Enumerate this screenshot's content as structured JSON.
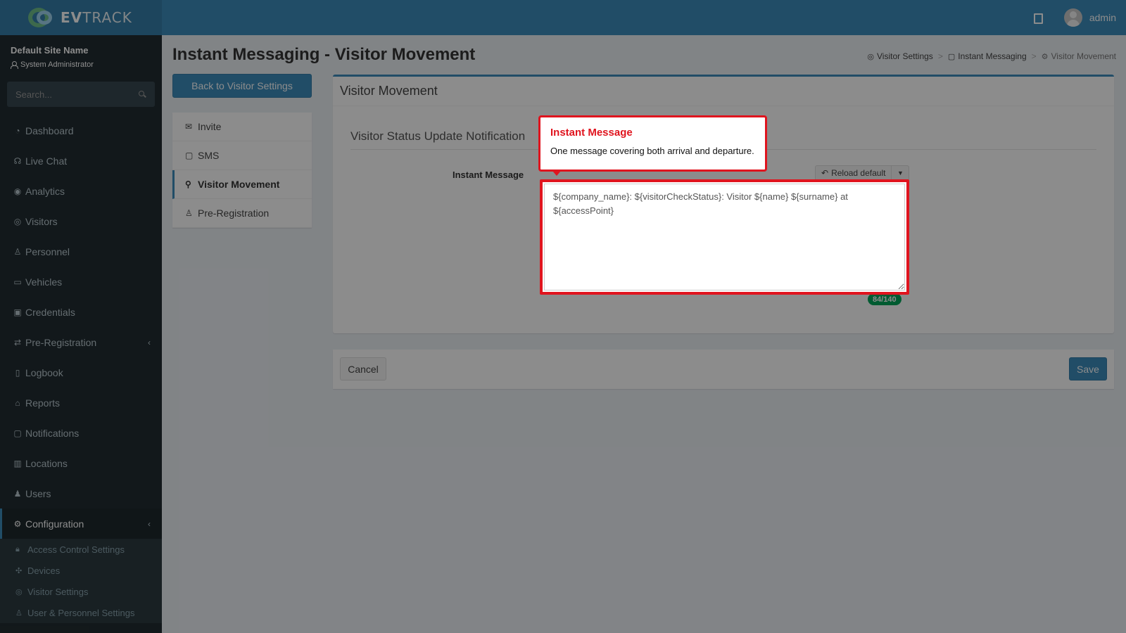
{
  "header": {
    "logo_bold": "EV",
    "logo_light": "TRACK",
    "user_name": "admin"
  },
  "sidebar": {
    "site_name": "Default Site Name",
    "role": "System Administrator",
    "search_placeholder": "Search...",
    "items": [
      {
        "label": "Dashboard",
        "icon": "dashboard-icon"
      },
      {
        "label": "Live Chat",
        "icon": "headset-icon"
      },
      {
        "label": "Analytics",
        "icon": "target-icon"
      },
      {
        "label": "Visitors",
        "icon": "eye-icon"
      },
      {
        "label": "Personnel",
        "icon": "personnel-icon"
      },
      {
        "label": "Vehicles",
        "icon": "car-icon"
      },
      {
        "label": "Credentials",
        "icon": "credentials-icon"
      },
      {
        "label": "Pre-Registration",
        "icon": "arrows-icon"
      },
      {
        "label": "Logbook",
        "icon": "book-icon"
      },
      {
        "label": "Reports",
        "icon": "reports-icon"
      },
      {
        "label": "Notifications",
        "icon": "chat-icon"
      },
      {
        "label": "Locations",
        "icon": "map-icon"
      },
      {
        "label": "Users",
        "icon": "users-icon"
      },
      {
        "label": "Configuration",
        "icon": "gear-icon"
      }
    ],
    "config_submenu": [
      {
        "label": "Access Control Settings",
        "icon": "lock-icon"
      },
      {
        "label": "Devices",
        "icon": "devices-icon"
      },
      {
        "label": "Visitor Settings",
        "icon": "eye-icon"
      },
      {
        "label": "User & Personnel Settings",
        "icon": "user-settings-icon"
      }
    ]
  },
  "page": {
    "title": "Instant Messaging - Visitor Movement",
    "breadcrumb": [
      "Visitor Settings",
      "Instant Messaging",
      "Visitor Movement"
    ],
    "back_button": "Back to Visitor Settings",
    "sub_nav": [
      "Invite",
      "SMS",
      "Visitor Movement",
      "Pre-Registration"
    ],
    "box_title": "Visitor Movement",
    "section_title": "Visitor Status Update Notification",
    "field_label": "Instant Message",
    "reload_label": "Reload default",
    "message": "${company_name}: ${visitorCheckStatus}: Visitor ${name} ${surname} at ${accessPoint}",
    "counter": "84/140",
    "cancel": "Cancel",
    "save": "Save"
  },
  "tooltip": {
    "title": "Instant Message",
    "body": "One message covering both arrival and departure."
  },
  "colors": {
    "primary": "#3c8dbc",
    "sidebar": "#222d32",
    "highlight": "#e0141e",
    "success": "#00a65a"
  }
}
